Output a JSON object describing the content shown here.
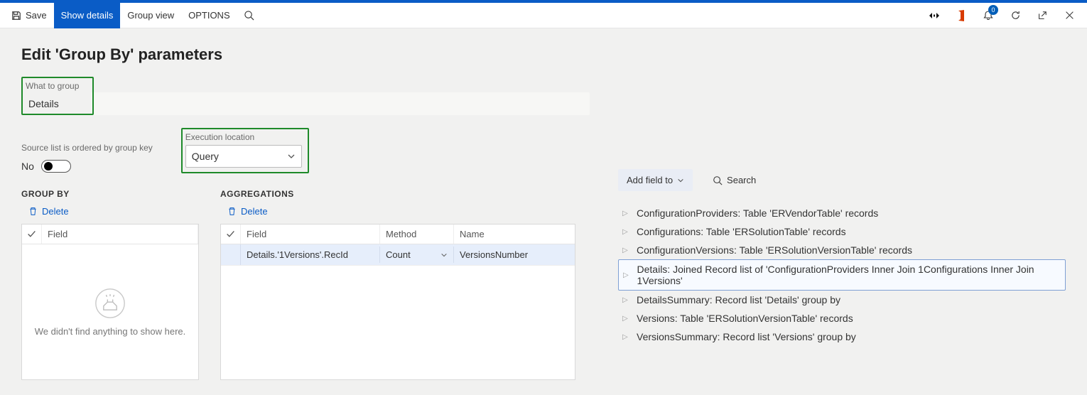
{
  "toolbar": {
    "save_label": "Save",
    "show_details_label": "Show details",
    "group_view_label": "Group view",
    "options_label": "OPTIONS",
    "notification_count": "0"
  },
  "page": {
    "title": "Edit 'Group By' parameters"
  },
  "what_to_group": {
    "label": "What to group",
    "value": "Details"
  },
  "source_ordered": {
    "label": "Source list is ordered by group key",
    "value_text": "No"
  },
  "exec_location": {
    "label": "Execution location",
    "value": "Query"
  },
  "groupby": {
    "heading": "GROUP BY",
    "delete_label": "Delete",
    "field_header": "Field",
    "empty_text": "We didn't find anything to show here."
  },
  "aggreg": {
    "heading": "AGGREGATIONS",
    "delete_label": "Delete",
    "headers": {
      "field": "Field",
      "method": "Method",
      "name": "Name"
    },
    "rows": [
      {
        "field": "Details.'1Versions'.RecId",
        "method": "Count",
        "name": "VersionsNumber"
      }
    ]
  },
  "right": {
    "add_field_label": "Add field to",
    "search_label": "Search",
    "tree": [
      {
        "label": "ConfigurationProviders: Table 'ERVendorTable' records",
        "selected": false
      },
      {
        "label": "Configurations: Table 'ERSolutionTable' records",
        "selected": false
      },
      {
        "label": "ConfigurationVersions: Table 'ERSolutionVersionTable' records",
        "selected": false
      },
      {
        "label": "Details: Joined Record list of 'ConfigurationProviders Inner Join 1Configurations Inner Join 1Versions'",
        "selected": true
      },
      {
        "label": "DetailsSummary: Record list 'Details' group by",
        "selected": false
      },
      {
        "label": "Versions: Table 'ERSolutionVersionTable' records",
        "selected": false
      },
      {
        "label": "VersionsSummary: Record list 'Versions' group by",
        "selected": false
      }
    ]
  }
}
